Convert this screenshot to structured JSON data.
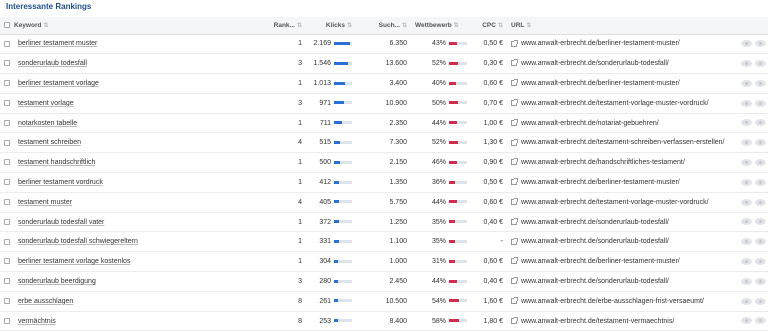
{
  "title": "Interessante Rankings",
  "columns": {
    "keyword": "Keyword",
    "rank": "Rank...",
    "klicks": "Klicks",
    "such": "Such...",
    "wettbewerb": "Wettbewerb",
    "cpc": "CPC",
    "url": "URL"
  },
  "colors": {
    "klicks_bar": "#2a6fd6",
    "wettbewerb_bar": "#d12d4f"
  },
  "rows": [
    {
      "keyword": "berliner testament muster",
      "rank": "1",
      "klicks": "2.169",
      "klicks_level": 0.9,
      "such": "6.350",
      "wettbewerb": "43%",
      "wettbewerb_level": 0.43,
      "cpc": "0,50 €",
      "url": "www.anwalt-erbrecht.de/berliner-testament-muster/"
    },
    {
      "keyword": "sonderurlaub todesfall",
      "rank": "3",
      "klicks": "1.546",
      "klicks_level": 0.75,
      "such": "13.600",
      "wettbewerb": "52%",
      "wettbewerb_level": 0.52,
      "cpc": "0,30 €",
      "url": "www.anwalt-erbrecht.de/sonderurlaub-todesfall/"
    },
    {
      "keyword": "berliner testament vorlage",
      "rank": "1",
      "klicks": "1.013",
      "klicks_level": 0.6,
      "such": "3.400",
      "wettbewerb": "40%",
      "wettbewerb_level": 0.4,
      "cpc": "0,60 €",
      "url": "www.anwalt-erbrecht.de/berliner-testament-muster/"
    },
    {
      "keyword": "testament vorlage",
      "rank": "3",
      "klicks": "971",
      "klicks_level": 0.55,
      "such": "10.900",
      "wettbewerb": "50%",
      "wettbewerb_level": 0.5,
      "cpc": "0,70 €",
      "url": "www.anwalt-erbrecht.de/testament-vorlage-muster-vordruck/"
    },
    {
      "keyword": "notarkosten tabelle",
      "rank": "1",
      "klicks": "711",
      "klicks_level": 0.45,
      "such": "2.350",
      "wettbewerb": "44%",
      "wettbewerb_level": 0.44,
      "cpc": "1,00 €",
      "url": "www.anwalt-erbrecht.de/notariat-gebuehren/"
    },
    {
      "keyword": "testament schreiben",
      "rank": "4",
      "klicks": "515",
      "klicks_level": 0.35,
      "such": "7.300",
      "wettbewerb": "52%",
      "wettbewerb_level": 0.52,
      "cpc": "1,30 €",
      "url": "www.anwalt-erbrecht.de/testament-schreiben-verfassen-erstellen/"
    },
    {
      "keyword": "testament handschriftlich",
      "rank": "1",
      "klicks": "500",
      "klicks_level": 0.35,
      "such": "2.150",
      "wettbewerb": "46%",
      "wettbewerb_level": 0.46,
      "cpc": "0,90 €",
      "url": "www.anwalt-erbrecht.de/handschriftliches-testament/"
    },
    {
      "keyword": "berliner testament vordruck",
      "rank": "1",
      "klicks": "412",
      "klicks_level": 0.3,
      "such": "1.350",
      "wettbewerb": "36%",
      "wettbewerb_level": 0.36,
      "cpc": "0,50 €",
      "url": "www.anwalt-erbrecht.de/berliner-testament-muster/"
    },
    {
      "keyword": "testament muster",
      "rank": "4",
      "klicks": "405",
      "klicks_level": 0.3,
      "such": "5.750",
      "wettbewerb": "44%",
      "wettbewerb_level": 0.44,
      "cpc": "0,60 €",
      "url": "www.anwalt-erbrecht.de/testament-vorlage-muster-vordruck/"
    },
    {
      "keyword": "sonderurlaub todesfall vater",
      "rank": "1",
      "klicks": "372",
      "klicks_level": 0.28,
      "such": "1.250",
      "wettbewerb": "35%",
      "wettbewerb_level": 0.35,
      "cpc": "0,40 €",
      "url": "www.anwalt-erbrecht.de/sonderurlaub-todesfall/"
    },
    {
      "keyword": "sonderurlaub todesfall schwiegereltern",
      "rank": "1",
      "klicks": "331",
      "klicks_level": 0.25,
      "such": "1.100",
      "wettbewerb": "35%",
      "wettbewerb_level": 0.35,
      "cpc": "-",
      "url": "www.anwalt-erbrecht.de/sonderurlaub-todesfall/"
    },
    {
      "keyword": "berliner testament vorlage kostenlos",
      "rank": "1",
      "klicks": "304",
      "klicks_level": 0.22,
      "such": "1.000",
      "wettbewerb": "31%",
      "wettbewerb_level": 0.31,
      "cpc": "0,60 €",
      "url": "www.anwalt-erbrecht.de/berliner-testament-muster/"
    },
    {
      "keyword": "sonderurlaub beerdigung",
      "rank": "3",
      "klicks": "280",
      "klicks_level": 0.2,
      "such": "2.450",
      "wettbewerb": "44%",
      "wettbewerb_level": 0.44,
      "cpc": "0,40 €",
      "url": "www.anwalt-erbrecht.de/sonderurlaub-todesfall/"
    },
    {
      "keyword": "erbe ausschlagen",
      "rank": "8",
      "klicks": "261",
      "klicks_level": 0.2,
      "such": "10.500",
      "wettbewerb": "54%",
      "wettbewerb_level": 0.54,
      "cpc": "1,60 €",
      "url": "www.anwalt-erbrecht.de/erbe-ausschlagen-frist-versaeumt/"
    },
    {
      "keyword": "vermächtnis",
      "rank": "8",
      "klicks": "253",
      "klicks_level": 0.2,
      "such": "8.400",
      "wettbewerb": "58%",
      "wettbewerb_level": 0.58,
      "cpc": "1,80 €",
      "url": "www.anwalt-erbrecht.de/testament-vermaechtnis/"
    }
  ]
}
